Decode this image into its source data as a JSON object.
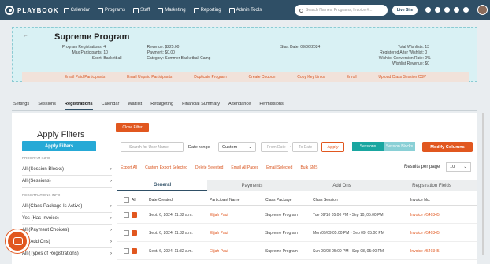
{
  "topbar": {
    "brand": "PLAYBOOK",
    "nav": [
      "Calendar",
      "Programs",
      "Staff",
      "Marketing",
      "Reporting",
      "Admin Tools"
    ],
    "search_placeholder": "Search Names, Programs, Invoice #...",
    "live_site": "Live Site"
  },
  "program": {
    "title": "Supreme Program",
    "col1": [
      {
        "k": "Program Registrations:",
        "v": "4"
      },
      {
        "k": "Max Participants:",
        "v": "10"
      },
      {
        "k": "Sport:",
        "v": "Basketball"
      }
    ],
    "col2": [
      {
        "k": "Revenue:",
        "v": "$225.00"
      },
      {
        "k": "Payment:",
        "v": "$0.00"
      },
      {
        "k": "Category:",
        "v": "Summer Basketball Camp"
      }
    ],
    "start_date_label": "Start Date:",
    "start_date": "09/06/2024",
    "col4": [
      {
        "k": "Total Wishlists:",
        "v": "13"
      },
      {
        "k": "Registered After Wishlist:",
        "v": "0"
      },
      {
        "k": "Wishlist Conversion Rate:",
        "v": "0%"
      },
      {
        "k": "Wishlist Revenue:",
        "v": "$0"
      }
    ],
    "actions": [
      "Email Paid Participants",
      "Email Unpaid Participants",
      "Duplicate Program",
      "Create Coupon",
      "Copy Key Links",
      "Enroll",
      "Upload Class Session CSV"
    ]
  },
  "tabs": [
    "Settings",
    "Sessions",
    "Registrations",
    "Calendar",
    "Waitlist",
    "Retargeting",
    "Financial Summary",
    "Attendance",
    "Permissions"
  ],
  "filters": {
    "title": "Apply Filters",
    "apply_button": "Apply Filters",
    "section_program": "PROGRAM INFO",
    "section_registration": "REGISTRATIONS INFO",
    "program_items": [
      "All (Session Blocks)",
      "All (Sessions)"
    ],
    "registration_items": [
      "All (Class Package Is Active)",
      "Yes (Has Invoice)",
      "All (Payment Choices)",
      "All (Add Ons)",
      "All (Types of Registrations)"
    ]
  },
  "toolbar": {
    "close_filter": "Close Filter",
    "user_search_placeholder": "Search for User Name",
    "date_range_label": "Date range",
    "date_range_value": "Custom",
    "from_placeholder": "From Date",
    "to_placeholder": "To Date",
    "apply": "Apply",
    "toggle_on": "Sessions",
    "toggle_off": "Session Blocks",
    "modify_columns": "Modify Columns",
    "actions": [
      "Export All",
      "Custom Export Selected",
      "Delete Selected",
      "Email All Pages",
      "Email Selected",
      "Bulk SMS"
    ],
    "results_label": "Results per page",
    "results_value": "10"
  },
  "grid_tabs": [
    "General",
    "Payments",
    "Add Ons",
    "Registration Fields"
  ],
  "table": {
    "headers": [
      "All",
      "Date Created",
      "Participant Name",
      "Class Package",
      "Class Session",
      "Invoice No."
    ],
    "rows": [
      {
        "date": "Sept. 6, 2024, 11:32 a.m.",
        "name": "Elijah Paul",
        "package": "Supreme Program",
        "session": "Tue 09/10 05:00 PM - Sep 10, 05:00 PM",
        "invoice": "Invoice #540345"
      },
      {
        "date": "Sept. 6, 2024, 11:32 a.m.",
        "name": "Elijah Paul",
        "package": "Supreme Program",
        "session": "Mon 09/09 05:00 PM - Sep 09, 05:00 PM",
        "invoice": "Invoice #540345"
      },
      {
        "date": "Sept. 6, 2024, 11:32 a.m.",
        "name": "Elijah Paul",
        "package": "Supreme Program",
        "session": "Sun 09/08 05:00 PM - Sep 08, 05:00 PM",
        "invoice": "Invoice #540345"
      }
    ]
  },
  "colors": {
    "accent": "#e1571f",
    "nav": "#2f4f66",
    "teal": "#19a6a0",
    "header_bg": "#d9f1f4"
  }
}
